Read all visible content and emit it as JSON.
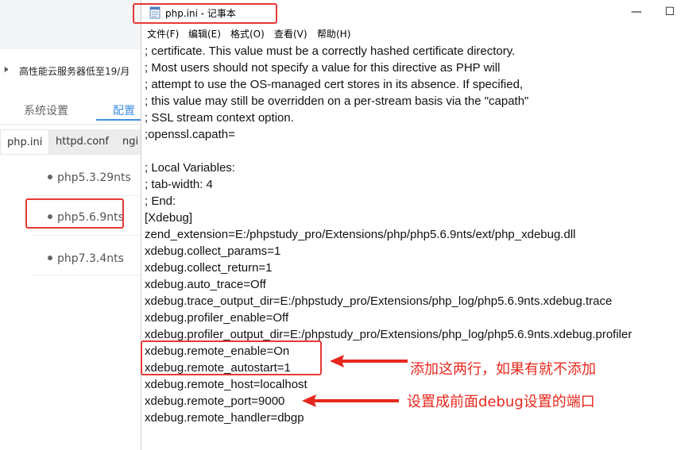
{
  "background_app": {
    "notice": "高性能云服务器低至19/月",
    "tabs": [
      "系统设置",
      "配置"
    ],
    "file_tabs": [
      "php.ini",
      "httpd.conf",
      "ngi"
    ],
    "versions": [
      "php5.3.29nts",
      "php5.6.9nts",
      "php7.3.4nts"
    ]
  },
  "notepad": {
    "title": "php.ini - 记事本",
    "menu": [
      "文件(F)",
      "编辑(E)",
      "格式(O)",
      "查看(V)",
      "帮助(H)"
    ],
    "lines": [
      "; certificate. This value must be a correctly hashed certificate directory.",
      "; Most users should not specify a value for this directive as PHP will",
      "; attempt to use the OS-managed cert stores in its absence. If specified,",
      "; this value may still be overridden on a per-stream basis via the \"capath\"",
      "; SSL stream context option.",
      ";openssl.capath=",
      "",
      "; Local Variables:",
      "; tab-width: 4",
      "; End:",
      "[Xdebug]",
      "zend_extension=E:/phpstudy_pro/Extensions/php/php5.6.9nts/ext/php_xdebug.dll",
      "xdebug.collect_params=1",
      "xdebug.collect_return=1",
      "xdebug.auto_trace=Off",
      "xdebug.trace_output_dir=E:/phpstudy_pro/Extensions/php_log/php5.6.9nts.xdebug.trace",
      "xdebug.profiler_enable=Off",
      "xdebug.profiler_output_dir=E:/phpstudy_pro/Extensions/php_log/php5.6.9nts.xdebug.profiler",
      "xdebug.remote_enable=On",
      "xdebug.remote_autostart=1",
      "xdebug.remote_host=localhost",
      "xdebug.remote_port=9000",
      "xdebug.remote_handler=dbgp"
    ]
  },
  "annotations": {
    "note1": "添加这两行，如果有就不添加",
    "note2": "设置成前面debug设置的端口",
    "color": "#e8281e"
  }
}
